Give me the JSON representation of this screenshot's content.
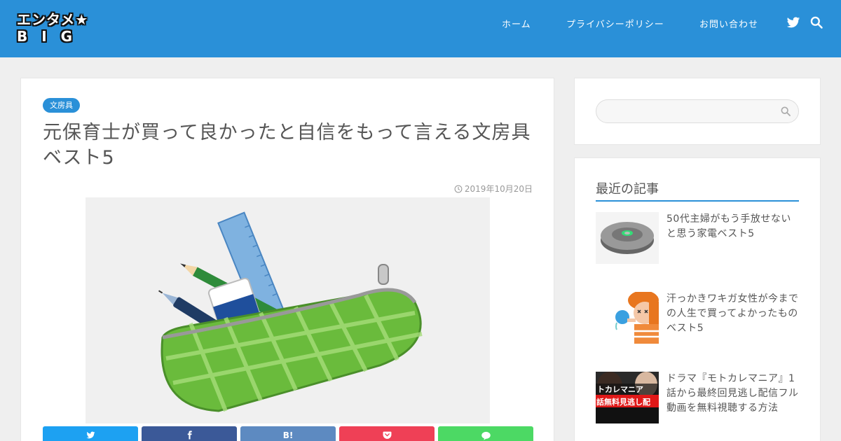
{
  "site": {
    "logo_line1": "エンタメ★",
    "logo_line2": "BIG"
  },
  "nav": {
    "items": [
      {
        "label": "ホーム"
      },
      {
        "label": "プライバシーポリシー"
      },
      {
        "label": "お問い合わせ"
      }
    ],
    "icons": [
      "twitter-icon",
      "search-icon"
    ]
  },
  "article": {
    "category": "文房具",
    "title": "元保育士が買って良かったと自信をもって言える文房具ベスト5",
    "date": "2019年10月20日",
    "share_buttons": [
      {
        "service": "twitter",
        "label": "",
        "color": "#1da1f2"
      },
      {
        "service": "facebook",
        "label": "",
        "color": "#3b5998"
      },
      {
        "service": "hatena",
        "label": "B!",
        "color": "#5d8ac1"
      },
      {
        "service": "pocket",
        "label": "",
        "color": "#ef4056"
      },
      {
        "service": "line",
        "label": "",
        "color": "#4cd964"
      }
    ]
  },
  "sidebar": {
    "search": {
      "placeholder": ""
    },
    "recent": {
      "title": "最近の記事",
      "posts": [
        {
          "title": "50代主婦がもう手放せないと思う家電ベスト5"
        },
        {
          "title": "汗っかきワキガ女性が今までの人生で買ってよかったものベスト5"
        },
        {
          "title": "ドラマ『モトカレマニア』1話から最終回見逃し配信フル動画を無料視聴する方法",
          "thumb_text": "トカレマニア",
          "thumb_text2": "話無料見逃し配"
        }
      ]
    }
  },
  "colors": {
    "brand": "#2a90d8",
    "background": "#efefef"
  }
}
